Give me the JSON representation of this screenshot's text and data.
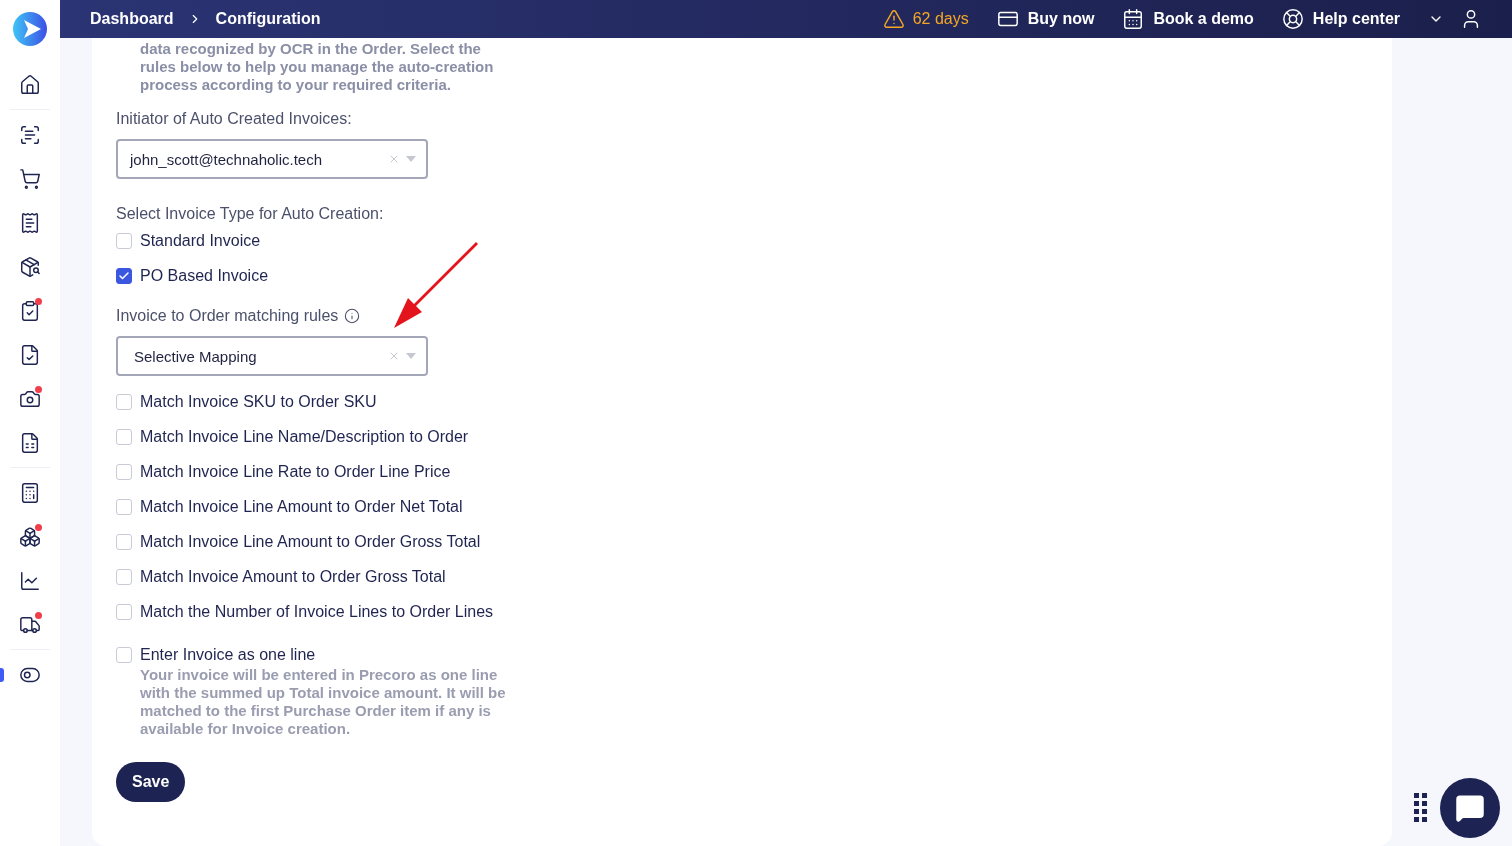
{
  "sidebar": {
    "groups": [
      {
        "items": [
          {
            "dot": false,
            "selected": false
          }
        ]
      },
      {
        "items": [
          {
            "dot": false,
            "selected": false
          },
          {
            "dot": false,
            "selected": false
          },
          {
            "dot": false,
            "selected": false
          },
          {
            "dot": false,
            "selected": false
          },
          {
            "dot": true,
            "selected": false
          },
          {
            "dot": false,
            "selected": false
          },
          {
            "dot": true,
            "selected": false
          },
          {
            "dot": false,
            "selected": false
          }
        ]
      },
      {
        "items": [
          {
            "dot": false,
            "selected": false
          },
          {
            "dot": true,
            "selected": false
          },
          {
            "dot": false,
            "selected": false
          },
          {
            "dot": true,
            "selected": false
          }
        ]
      },
      {
        "items": [
          {
            "dot": false,
            "selected": true
          }
        ]
      }
    ]
  },
  "topbar": {
    "breadcrumbs": [
      "Dashboard",
      "Configuration"
    ],
    "trial": "62 days",
    "links": [
      "Buy now",
      "Book a demo",
      "Help center"
    ]
  },
  "form": {
    "intro": "data recognized by OCR in the Order. Select the\nrules below to help you manage the auto-creation\nprocess according to your required criteria.",
    "initiator": {
      "label": "Initiator of Auto Created Invoices:",
      "value": "john_scott@technaholic.tech"
    },
    "invoice_types": {
      "label": "Select Invoice Type for Auto Creation:",
      "options": [
        {
          "label": "Standard Invoice",
          "checked": false
        },
        {
          "label": "PO Based Invoice",
          "checked": true
        }
      ]
    },
    "matching": {
      "label": "Invoice to Order matching rules",
      "value": "Selective Mapping",
      "rules": [
        {
          "label": "Match Invoice SKU to Order SKU",
          "checked": false
        },
        {
          "label": "Match Invoice Line Name/Description to Order",
          "checked": false
        },
        {
          "label": "Match Invoice Line Rate to Order Line Price",
          "checked": false
        },
        {
          "label": "Match Invoice Line Amount to Order Net Total",
          "checked": false
        },
        {
          "label": "Match Invoice Line Amount to Order Gross Total",
          "checked": false
        },
        {
          "label": "Match Invoice Amount to Order Gross Total",
          "checked": false
        },
        {
          "label": "Match the Number of Invoice Lines to Order Lines",
          "checked": false
        }
      ]
    },
    "one_line": {
      "label": "Enter Invoice as one line",
      "checked": false,
      "help": "Your invoice will be entered in Precoro as one line\nwith the summed up Total invoice amount. It will be\nmatched to the first Purchase Order item if any is\navailable for Invoice creation."
    },
    "save": "Save"
  }
}
